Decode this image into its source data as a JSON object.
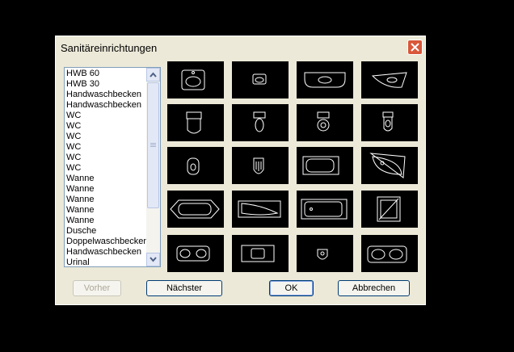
{
  "dialog": {
    "title": "Sanitäreinrichtungen",
    "close_icon": "close-x-icon",
    "accent": "#d9573a"
  },
  "list": {
    "items": [
      "HWB 60",
      "HWB 30",
      "Handwaschbecken",
      "Handwaschbecken",
      "WC",
      "WC",
      "WC",
      "WC",
      "WC",
      "WC",
      "Wanne",
      "Wanne",
      "Wanne",
      "Wanne",
      "Wanne",
      "Dusche",
      "Doppelwaschbecken",
      "Handwaschbecken",
      "Urinal"
    ]
  },
  "tiles": [
    {
      "name": "washbasin-large-icon"
    },
    {
      "name": "washbasin-small-icon"
    },
    {
      "name": "countertop-basin-icon"
    },
    {
      "name": "corner-basin-icon"
    },
    {
      "name": "wc-large-icon"
    },
    {
      "name": "wc-tank-icon"
    },
    {
      "name": "wc-round-icon"
    },
    {
      "name": "wc-narrow-icon"
    },
    {
      "name": "wc-compact-icon"
    },
    {
      "name": "wc-wall-icon"
    },
    {
      "name": "bathtub-rect-icon"
    },
    {
      "name": "bathtub-corner-icon"
    },
    {
      "name": "bathtub-octagon-icon"
    },
    {
      "name": "bathtub-tapered-icon"
    },
    {
      "name": "bathtub-built-in-icon"
    },
    {
      "name": "shower-tray-icon"
    },
    {
      "name": "double-washbasin-icon"
    },
    {
      "name": "handbasin-counter-icon"
    },
    {
      "name": "urinal-icon"
    },
    {
      "name": "double-sink-icon"
    }
  ],
  "buttons": {
    "prev": "Vorher",
    "next": "Nächster",
    "ok": "OK",
    "cancel": "Abbrechen"
  }
}
